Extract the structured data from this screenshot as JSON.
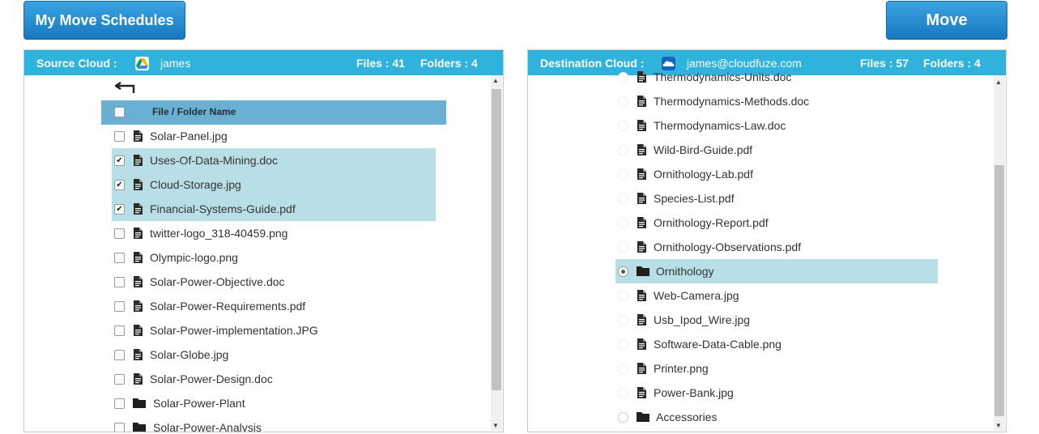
{
  "toolbar": {
    "schedules_label": "My Move Schedules",
    "move_label": "Move"
  },
  "source": {
    "title": "Source Cloud :",
    "cloud_icon": "google-drive-icon",
    "user": "james",
    "files_count": "Files : 41",
    "folders_count": "Folders : 4",
    "column_header": "File / Folder Name",
    "items": [
      {
        "name": "Solar-Panel.jpg",
        "type": "file",
        "checked": false
      },
      {
        "name": "Uses-Of-Data-Mining.doc",
        "type": "file",
        "checked": true
      },
      {
        "name": "Cloud-Storage.jpg",
        "type": "file",
        "checked": true
      },
      {
        "name": "Financial-Systems-Guide.pdf",
        "type": "file",
        "checked": true
      },
      {
        "name": "twitter-logo_318-40459.png",
        "type": "file",
        "checked": false
      },
      {
        "name": "Olympic-logo.png",
        "type": "file",
        "checked": false
      },
      {
        "name": "Solar-Power-Objective.doc",
        "type": "file",
        "checked": false
      },
      {
        "name": "Solar-Power-Requirements.pdf",
        "type": "file",
        "checked": false
      },
      {
        "name": "Solar-Power-implementation.JPG",
        "type": "file",
        "checked": false
      },
      {
        "name": "Solar-Globe.jpg",
        "type": "file",
        "checked": false
      },
      {
        "name": "Solar-Power-Design.doc",
        "type": "file",
        "checked": false
      },
      {
        "name": "Solar-Power-Plant",
        "type": "folder",
        "checked": false
      },
      {
        "name": "Solar-Power-Analysis",
        "type": "folder",
        "checked": false
      }
    ]
  },
  "destination": {
    "title": "Destination Cloud :",
    "cloud_icon": "onedrive-icon",
    "user": "james@cloudfuze.com",
    "files_count": "Files : 57",
    "folders_count": "Folders : 4",
    "items": [
      {
        "name": "Thermodynamics-Units.doc",
        "type": "file"
      },
      {
        "name": "Thermodynamics-Methods.doc",
        "type": "file"
      },
      {
        "name": "Thermodynamics-Law.doc",
        "type": "file"
      },
      {
        "name": "Wild-Bird-Guide.pdf",
        "type": "file"
      },
      {
        "name": "Ornithology-Lab.pdf",
        "type": "file"
      },
      {
        "name": "Species-List.pdf",
        "type": "file"
      },
      {
        "name": "Ornithology-Report.pdf",
        "type": "file"
      },
      {
        "name": "Ornithology-Observations.pdf",
        "type": "file"
      },
      {
        "name": "Ornithology",
        "type": "folder",
        "selected": true
      },
      {
        "name": "Web-Camera.jpg",
        "type": "file"
      },
      {
        "name": "Usb_Ipod_Wire.jpg",
        "type": "file"
      },
      {
        "name": "Software-Data-Cable.png",
        "type": "file"
      },
      {
        "name": "Printer.png",
        "type": "file"
      },
      {
        "name": "Power-Bank.jpg",
        "type": "file"
      },
      {
        "name": "Accessories",
        "type": "folder"
      }
    ]
  },
  "colors": {
    "header": "#2fb3dc",
    "selected_row": "#b8dfe6",
    "column_header": "#6ab0d3",
    "button": "#1f86cf"
  }
}
